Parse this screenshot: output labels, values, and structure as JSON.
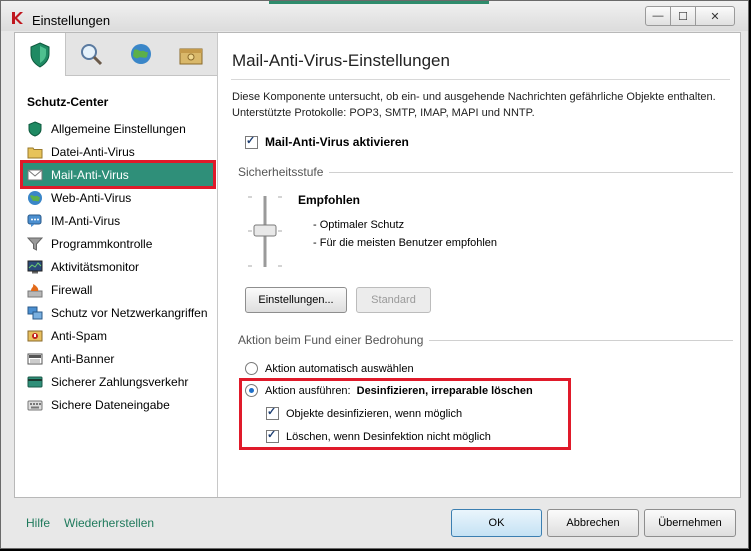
{
  "window": {
    "title": "Einstellungen",
    "controls": {
      "minimize": "—",
      "maximize": "☐",
      "close": "✕"
    }
  },
  "sidebar": {
    "heading": "Schutz-Center",
    "items": [
      {
        "label": "Allgemeine Einstellungen",
        "icon": "shield-icon"
      },
      {
        "label": "Datei-Anti-Virus",
        "icon": "folder-icon"
      },
      {
        "label": "Mail-Anti-Virus",
        "icon": "mail-icon",
        "selected": true
      },
      {
        "label": "Web-Anti-Virus",
        "icon": "globe-icon"
      },
      {
        "label": "IM-Anti-Virus",
        "icon": "chat-icon"
      },
      {
        "label": "Programmkontrolle",
        "icon": "funnel-icon"
      },
      {
        "label": "Aktivitätsmonitor",
        "icon": "monitor-icon"
      },
      {
        "label": "Firewall",
        "icon": "firewall-icon"
      },
      {
        "label": "Schutz vor Netzwerkangriffen",
        "icon": "network-icon"
      },
      {
        "label": "Anti-Spam",
        "icon": "spam-icon"
      },
      {
        "label": "Anti-Banner",
        "icon": "banner-icon"
      },
      {
        "label": "Sicherer Zahlungsverkehr",
        "icon": "card-icon"
      },
      {
        "label": "Sichere Dateneingabe",
        "icon": "keyboard-icon"
      }
    ]
  },
  "main": {
    "title": "Mail-Anti-Virus-Einstellungen",
    "desc_line1": "Diese Komponente untersucht, ob ein- und ausgehende Nachrichten gefährliche Objekte enthalten.",
    "desc_line2": "Unterstützte Protokolle: POP3, SMTP, IMAP, MAPI und NNTP.",
    "enable_label": "Mail-Anti-Virus aktivieren",
    "security_group": "Sicherheitsstufe",
    "level_name": "Empfohlen",
    "level_line1": "- Optimaler Schutz",
    "level_line2": "- Für die meisten Benutzer empfohlen",
    "settings_button": "Einstellungen...",
    "standard_button": "Standard",
    "action_group": "Aktion beim Fund einer Bedrohung",
    "radio_auto": "Aktion automatisch auswählen",
    "radio_exec": "Aktion ausführen:",
    "radio_exec_value": "Desinfizieren, irreparable löschen",
    "check_disinfect": "Objekte desinfizieren, wenn möglich",
    "check_delete": "Löschen, wenn Desinfektion nicht möglich"
  },
  "footer": {
    "help": "Hilfe",
    "restore": "Wiederherstellen",
    "ok": "OK",
    "cancel": "Abbrechen",
    "apply": "Übernehmen"
  },
  "colors": {
    "accent": "#2f8f79",
    "highlight": "#e01a2a",
    "link": "#1f7a5c"
  }
}
